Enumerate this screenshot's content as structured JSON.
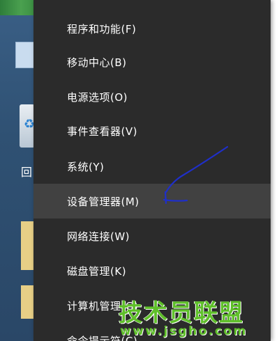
{
  "desktop": {
    "recycle_label": "回"
  },
  "menu": {
    "items": [
      {
        "label": "程序和功能(F)"
      },
      {
        "label": "移动中心(B)"
      },
      {
        "label": "电源选项(O)"
      },
      {
        "label": "事件查看器(V)"
      },
      {
        "label": "系统(Y)"
      },
      {
        "label": "设备管理器(M)",
        "highlighted": true
      },
      {
        "label": "网络连接(W)"
      },
      {
        "label": "磁盘管理(K)"
      },
      {
        "label": "计算机管理(G)"
      },
      {
        "label": "命令提示符(C)"
      }
    ]
  },
  "annotation": {
    "arrow_color": "#1f2fc9"
  },
  "watermark": {
    "title": "技术员联盟",
    "url": "www.jsgho.com",
    "color": "#5fbf2a"
  }
}
